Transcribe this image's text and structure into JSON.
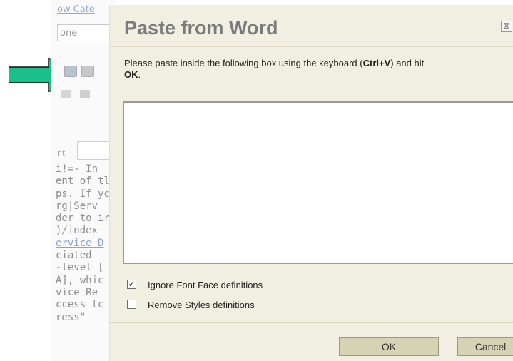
{
  "background_page": {
    "top_link": "ow Cate",
    "dropdown_value": "one",
    "font_label": "nt",
    "code_lines": [
      "i!=- In",
      "ent of tl",
      "ps. If yc",
      "rg|Serv",
      "der to ir",
      ")/index",
      "ervice D",
      "ciated",
      "-level [",
      "A], whic",
      "vice Re",
      "ccess tc",
      "ress\""
    ]
  },
  "dialog": {
    "title": "Paste from Word",
    "close_symbol": "⊠",
    "instructions": {
      "before": "Please paste inside the following box using the keyboard (",
      "shortcut": "Ctrl+V",
      "middle": ") and hit ",
      "ok_word": "OK",
      "after": "."
    },
    "options": [
      {
        "label": "Ignore Font Face definitions",
        "checked": true,
        "mark": "✓"
      },
      {
        "label": "Remove Styles definitions",
        "checked": false,
        "mark": ""
      }
    ],
    "buttons": {
      "ok": "OK",
      "cancel": "Cancel"
    }
  },
  "colors": {
    "arrow_fill": "#1bbf8a",
    "dialog_bg": "#f1efe2",
    "button_bg": "#d6d3b5"
  }
}
